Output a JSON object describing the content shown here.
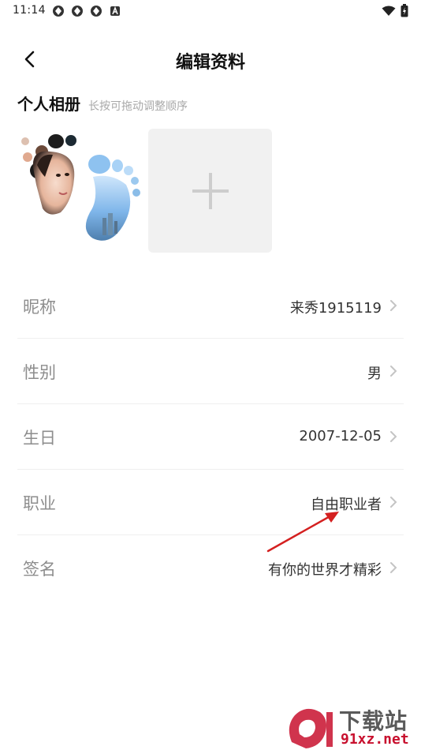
{
  "status_bar": {
    "time": "11:14",
    "notification_icons": [
      "app-icon",
      "app-icon",
      "app-icon",
      "a-badge-icon"
    ],
    "right_icons": [
      "wifi-icon",
      "battery-icon"
    ]
  },
  "nav": {
    "title": "编辑资料",
    "back_icon": "chevron-left-icon"
  },
  "album": {
    "title": "个人相册",
    "hint": "长按可拖动调整顺序",
    "photos": [
      {
        "alt": "footprint-photo"
      }
    ],
    "add_icon": "plus-icon"
  },
  "profile": {
    "rows": [
      {
        "label": "昵称",
        "value": "来秀1915119"
      },
      {
        "label": "性别",
        "value": "男"
      },
      {
        "label": "生日",
        "value": "2007-12-05"
      },
      {
        "label": "职业",
        "value": "自由职业者"
      },
      {
        "label": "签名",
        "value": "有你的世界才精彩"
      }
    ]
  },
  "watermark": {
    "text": "下载站",
    "url": "91xz.net"
  },
  "colors": {
    "label_gray": "#8d8d8d",
    "hint_gray": "#a8a8a8",
    "add_slot_bg": "#f1f1f1",
    "annotation_red": "#d42020"
  }
}
